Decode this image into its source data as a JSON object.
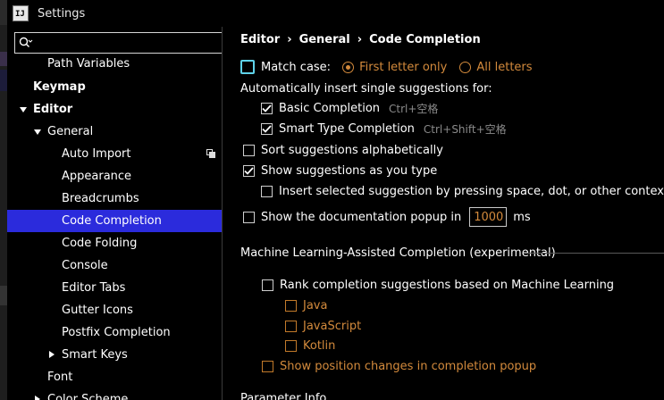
{
  "window": {
    "title": "Settings",
    "app_icon": "IJ"
  },
  "search": {
    "placeholder": "",
    "value": ""
  },
  "sidebar": {
    "items": [
      {
        "label": "Path Variables"
      },
      {
        "label": "Keymap"
      },
      {
        "label": "Editor"
      },
      {
        "label": "General"
      },
      {
        "label": "Auto Import"
      },
      {
        "label": "Appearance"
      },
      {
        "label": "Breadcrumbs"
      },
      {
        "label": "Code Completion"
      },
      {
        "label": "Code Folding"
      },
      {
        "label": "Console"
      },
      {
        "label": "Editor Tabs"
      },
      {
        "label": "Gutter Icons"
      },
      {
        "label": "Postfix Completion"
      },
      {
        "label": "Smart Keys"
      },
      {
        "label": "Font"
      },
      {
        "label": "Color Scheme"
      }
    ]
  },
  "breadcrumb": {
    "part1": "Editor",
    "sep": "›",
    "part2": "General",
    "part3": "Code Completion"
  },
  "completion": {
    "match_case_label": "Match case:",
    "match_case_checked": false,
    "first_letter_only": "First letter only",
    "all_letters": "All letters",
    "auto_insert_label": "Automatically insert single suggestions for:",
    "basic_completion": "Basic Completion",
    "basic_shortcut": "Ctrl+空格",
    "smart_completion": "Smart Type Completion",
    "smart_shortcut": "Ctrl+Shift+空格",
    "sort_alpha": "Sort suggestions alphabetically",
    "show_as_type": "Show suggestions as you type",
    "insert_by_space": "Insert selected suggestion by pressing space, dot, or other context-dependent keys",
    "show_doc_popup": "Show the documentation popup in",
    "doc_popup_ms_value": "1000",
    "ms": "ms"
  },
  "ml_section": {
    "title": "Machine Learning-Assisted Completion (experimental)",
    "rank_label": "Rank completion suggestions based on Machine Learning",
    "java": "Java",
    "javascript": "JavaScript",
    "kotlin": "Kotlin",
    "show_position": "Show position changes in completion popup"
  },
  "param_section": {
    "title": "Parameter Info"
  },
  "colors": {
    "selection": "#2b2bdc",
    "accent_orange": "#d38a3c",
    "focus_ring": "#5fd3ea"
  }
}
